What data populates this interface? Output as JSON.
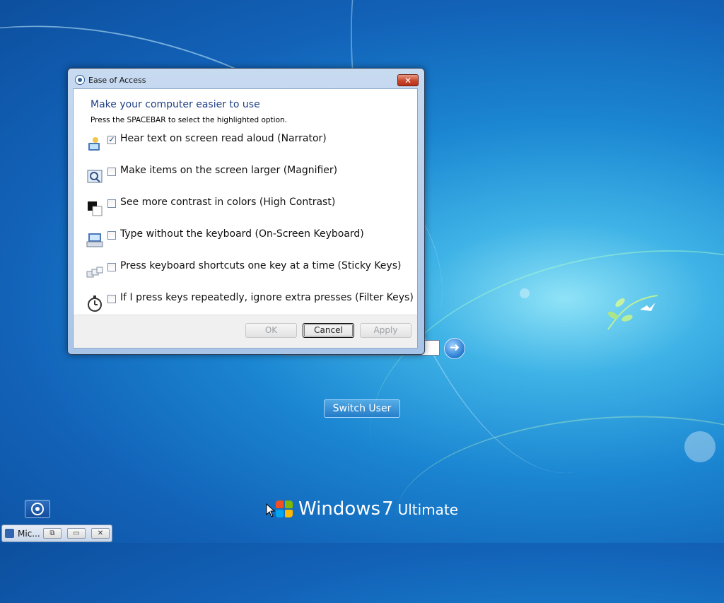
{
  "dialog": {
    "title": "Ease of Access",
    "close_label": "✕",
    "heading": "Make your computer easier to use",
    "instruction": "Press the SPACEBAR to select the highlighted option.",
    "options": [
      {
        "label": "Hear text on screen read aloud (Narrator)",
        "checked": true,
        "icon": "narrator-icon",
        "mark": "✓"
      },
      {
        "label": "Make items on the screen larger (Magnifier)",
        "checked": false,
        "icon": "magnifier-icon",
        "mark": ""
      },
      {
        "label": "See more contrast in colors (High Contrast)",
        "checked": false,
        "icon": "high-contrast-icon",
        "mark": ""
      },
      {
        "label": "Type without the keyboard (On-Screen Keyboard)",
        "checked": false,
        "icon": "on-screen-keyboard-icon",
        "mark": ""
      },
      {
        "label": "Press keyboard shortcuts one key at a time (Sticky Keys)",
        "checked": false,
        "icon": "sticky-keys-icon",
        "mark": ""
      },
      {
        "label": "If I press keys repeatedly, ignore extra presses (Filter Keys)",
        "checked": false,
        "icon": "filter-keys-icon",
        "mark": ""
      }
    ],
    "buttons": {
      "ok": "OK",
      "cancel": "Cancel",
      "apply": "Apply"
    }
  },
  "login": {
    "go_arrow": "➜",
    "switch_user_label": "Switch User"
  },
  "brand": {
    "product": "Windows",
    "version": "7",
    "edition": "Ultimate"
  },
  "taskbar": {
    "app_label": "Mic...",
    "restore_glyph": "⧉",
    "maximize_glyph": "▭",
    "close_glyph": "✕"
  },
  "colors": {
    "heading_blue": "#1f3f86",
    "close_red": "#c8472b",
    "logo_red": "#f25022",
    "logo_green": "#7fba00",
    "logo_blue": "#00a4ef",
    "logo_yellow": "#ffb900"
  }
}
